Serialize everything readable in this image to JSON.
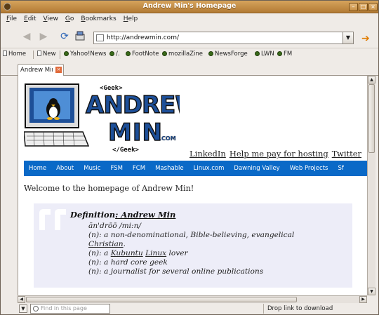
{
  "window": {
    "title": "Andrew Min's Homepage"
  },
  "menubar": [
    "File",
    "Edit",
    "View",
    "Go",
    "Bookmarks",
    "Help"
  ],
  "url": "http://andrewmin.com/",
  "bookmarks": [
    "Home",
    "New",
    "Yahoo!News",
    "/.",
    "FootNote",
    "mozillaZine",
    "NewsForge",
    "LWN",
    "FM"
  ],
  "tab": {
    "label": "Andrew Mir"
  },
  "logo_text": {
    "top": "<Geek>",
    "line1": "ANDREW",
    "line2": "MIN",
    "suffix": ".COM",
    "bottom": "</Geek>"
  },
  "toplinks": [
    "LinkedIn",
    "Help me pay for hosting",
    "Twitter"
  ],
  "sitenav": [
    "Home",
    "About",
    "Music",
    "FSM",
    "FCM",
    "Mashable",
    "Linux.com",
    "Dawning Valley",
    "Web Projects",
    "Sf"
  ],
  "welcome": "Welcome to the homepage of Andrew Min!",
  "definition": {
    "title_prefix": "Definition",
    "title_name": ": Andrew Min",
    "pronunciation": "ăn'drōō /mi:n/",
    "line1": "(n): a non-denominational, Bible-believing, evangelical",
    "line1b_link": "Christian",
    "line1b_after": ".",
    "line2_before": "(n): a ",
    "line2_link1": "Kubuntu",
    "line2_link2": "Linux",
    "line2_after": " lover",
    "line3": "(n): a hard core geek",
    "line4": "(n): a journalist for several online publications"
  },
  "findbar": {
    "placeholder": "Find in this page"
  },
  "status": "Drop link to download",
  "colors": {
    "titlebar": "#c08a45",
    "sitenav": "#0a69c7",
    "defbox": "#ededf8"
  }
}
